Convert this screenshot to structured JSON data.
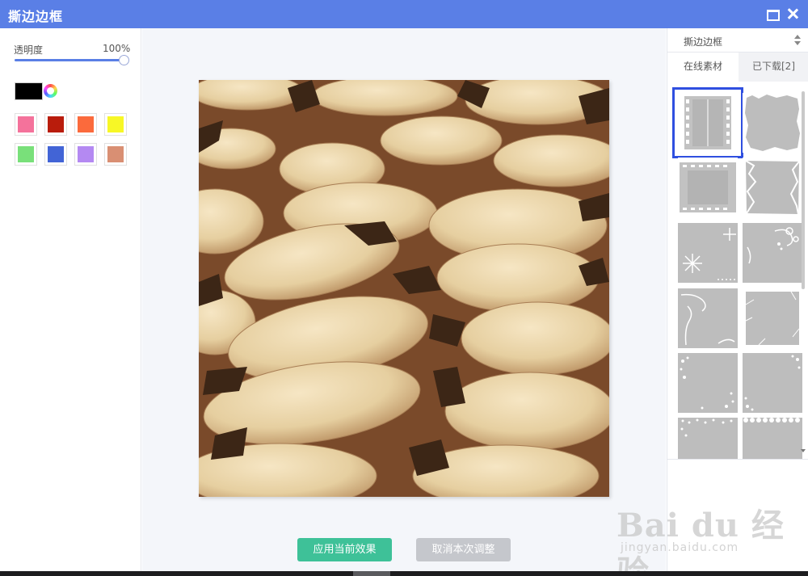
{
  "window": {
    "title": "撕边边框"
  },
  "left_panel": {
    "opacity_label": "透明度",
    "opacity_value": "100%",
    "opacity_level": 100,
    "current_color": "#000000",
    "swatches": [
      "#f4729b",
      "#b91c0c",
      "#fb6a3c",
      "#f7f726",
      "#79e07a",
      "#4264d6",
      "#b489f2",
      "#d98f73"
    ]
  },
  "canvas": {
    "apply_label": "应用当前效果",
    "cancel_label": "取消本次调整"
  },
  "right_panel": {
    "category": "撕边边框",
    "tabs": [
      {
        "label": "在线素材",
        "active": true
      },
      {
        "label": "已下载[2]",
        "active": false
      }
    ],
    "selected_index": 0
  },
  "watermark": {
    "logo": "Bai du 经验",
    "url": "jingyan.baidu.com"
  },
  "icons": {
    "maximize": "maximize-icon",
    "close": "close-icon",
    "color_picker": "color-wheel-icon",
    "dropdown": "select-arrows-icon"
  }
}
